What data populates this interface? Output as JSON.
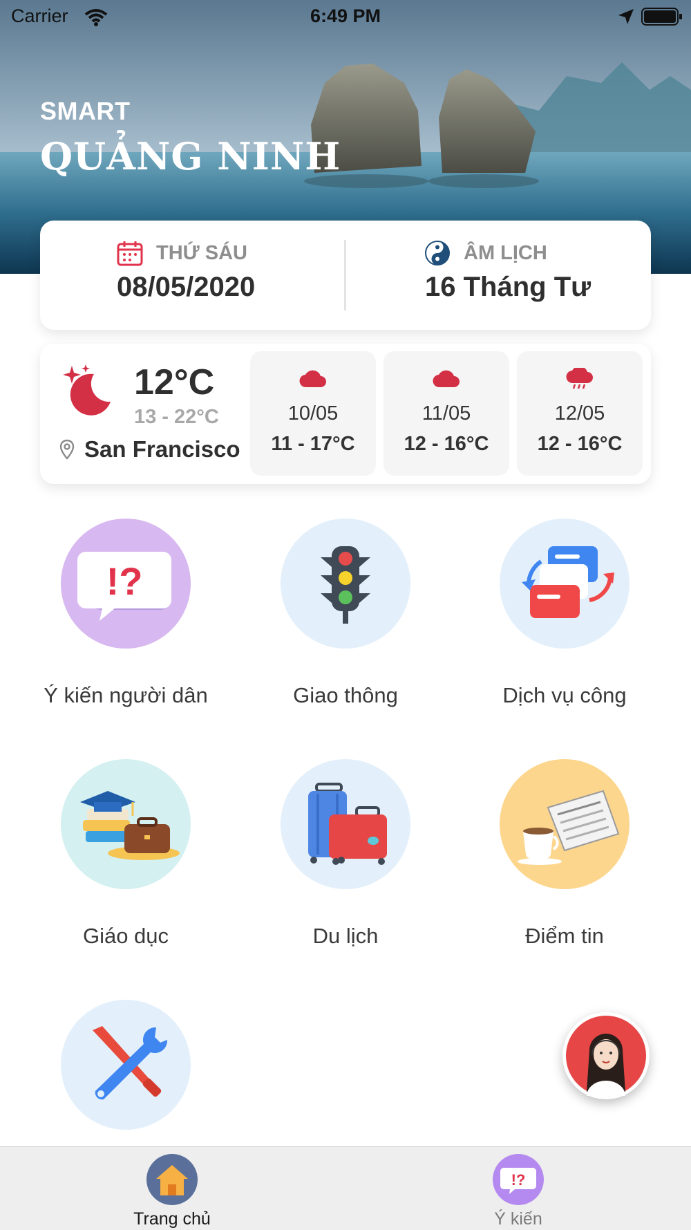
{
  "status_bar": {
    "carrier": "Carrier",
    "time": "6:49 PM"
  },
  "header": {
    "small_title": "SMART",
    "big_title": "QUẢNG NINH"
  },
  "date_card": {
    "weekday": "THỨ SÁU",
    "date": "08/05/2020",
    "lunar_label": "ÂM LỊCH",
    "lunar_date": "16 Tháng Tư"
  },
  "weather": {
    "current_temp": "12°C",
    "range": "13 - 22°C",
    "city": "San Francisco",
    "forecast": [
      {
        "date": "10/05",
        "range": "11 - 17°C",
        "icon": "cloud-icon"
      },
      {
        "date": "11/05",
        "range": "12 - 16°C",
        "icon": "cloud-icon"
      },
      {
        "date": "12/05",
        "range": "12 - 16°C",
        "icon": "cloud-rain-icon"
      }
    ]
  },
  "menu": [
    {
      "label": "Ý kiến người dân",
      "icon": "speech-bubble-question-icon"
    },
    {
      "label": "Giao thông",
      "icon": "traffic-light-icon"
    },
    {
      "label": "Dịch vụ công",
      "icon": "cards-exchange-icon"
    },
    {
      "label": "Giáo dục",
      "icon": "graduation-cap-books-icon"
    },
    {
      "label": "Du lịch",
      "icon": "luggage-icon"
    },
    {
      "label": "Điểm tin",
      "icon": "newspaper-coffee-icon"
    },
    {
      "label": "",
      "icon": "wrench-screwdriver-icon"
    }
  ],
  "tabbar": {
    "home": "Trang chủ",
    "feedback": "Ý kiến"
  },
  "colors": {
    "accent_red": "#e1334b",
    "tab_purple": "#9b6ee8",
    "weather_red": "#d32f45"
  }
}
